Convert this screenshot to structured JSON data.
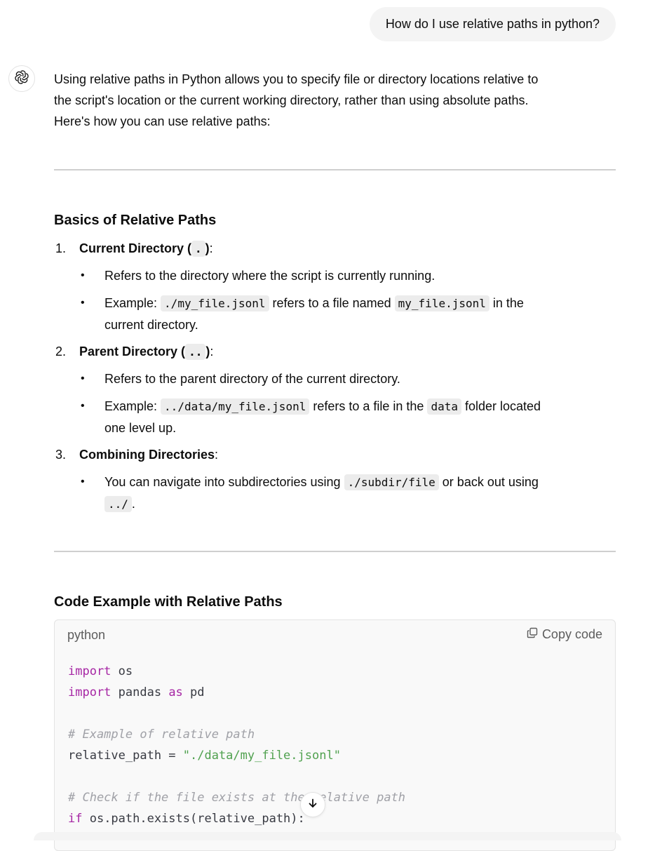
{
  "user_message": "How do I use relative paths in python?",
  "intro_line1": "Using relative paths in Python allows you to specify file or directory locations relative to",
  "intro_line2": "the script's location or the current working directory, rather than using absolute paths.",
  "intro_line3": "Here's how you can use relative paths:",
  "section1": {
    "heading": "Basics of Relative Paths",
    "items": [
      {
        "number": "1.",
        "label_pre": "Current Directory (",
        "label_code": ".",
        "label_post": ")",
        "colon": ":",
        "bullets": [
          {
            "text": "Refers to the directory where the script is currently running."
          },
          {
            "pre": "Example: ",
            "code1": "./my_file.jsonl",
            "mid": " refers to a file named ",
            "code2": "my_file.jsonl",
            "post": " in the",
            "line2": "current directory."
          }
        ]
      },
      {
        "number": "2.",
        "label_pre": "Parent Directory (",
        "label_code": "..",
        "label_post": ")",
        "colon": ":",
        "bullets": [
          {
            "text": "Refers to the parent directory of the current directory."
          },
          {
            "pre": "Example: ",
            "code1": "../data/my_file.jsonl",
            "mid": " refers to a file in the ",
            "code2": "data",
            "post": " folder located",
            "line2": "one level up."
          }
        ]
      },
      {
        "number": "3.",
        "label": "Combining Directories",
        "colon": ":",
        "bullets": [
          {
            "pre": "You can navigate into subdirectories using ",
            "code1": "./subdir/file",
            "post": " or back out using",
            "code2": "../",
            "end": "."
          }
        ]
      }
    ]
  },
  "section2": {
    "heading": "Code Example with Relative Paths"
  },
  "code_block": {
    "language": "python",
    "copy_label": "Copy code",
    "lines": {
      "l1_kw": "import",
      "l1_rest": " os",
      "l2_kw": "import",
      "l2_mid": " pandas ",
      "l2_kw2": "as",
      "l2_rest": " pd",
      "l4_comment": "# Example of relative path",
      "l5_var": "relative_path = ",
      "l5_str": "\"./data/my_file.jsonl\"",
      "l7_comment": "# Check if the file exists at the relative path",
      "l8_kw": "if",
      "l8_rest": " os.path.exists(relative_path):"
    }
  },
  "icons": {
    "avatar": "chatgpt-logo-icon",
    "copy": "copy-icon",
    "scroll": "arrow-down-icon"
  },
  "colors": {
    "keyword": "#a626a4",
    "string": "#50a14f",
    "comment": "#a0a1a7"
  }
}
